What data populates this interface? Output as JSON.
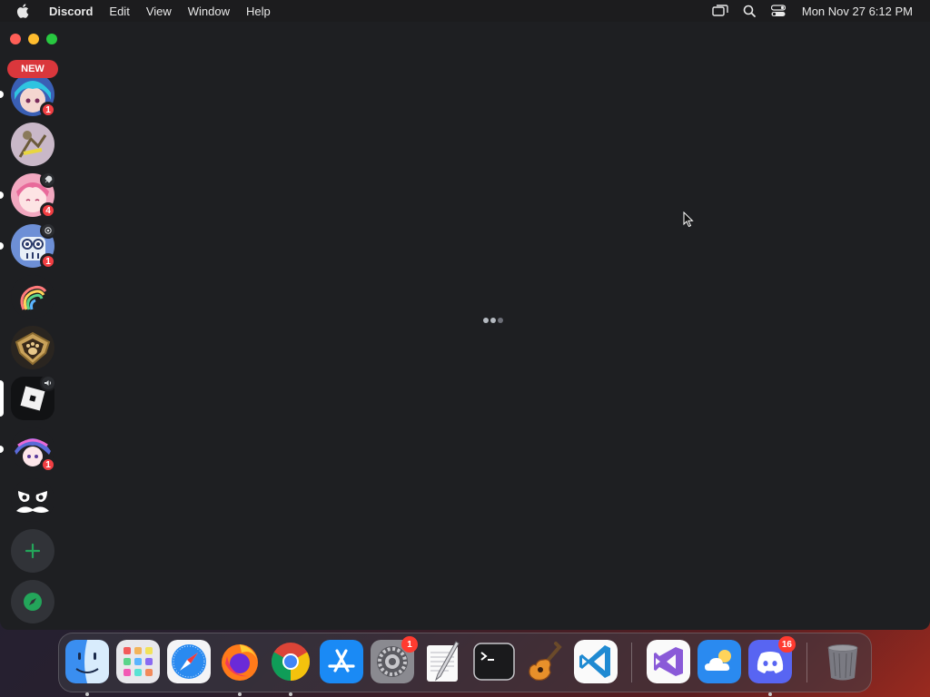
{
  "menubar": {
    "app_name": "Discord",
    "menus": [
      "Edit",
      "View",
      "Window",
      "Help"
    ],
    "clock": "Mon Nov 27  6:12 PM"
  },
  "window": {
    "new_label": "NEW",
    "servers": [
      {
        "id": "server-anime-blue",
        "badge": "1",
        "icon": "anime-avatar"
      },
      {
        "id": "server-sketch",
        "badge": "",
        "icon": "sketch-avatar"
      },
      {
        "id": "server-pink",
        "badge": "4",
        "icon": "anime-pink-avatar",
        "corner": "rocket-icon"
      },
      {
        "id": "server-cartoon",
        "badge": "1",
        "icon": "cartoon-avatar",
        "corner": "broadcast-icon"
      },
      {
        "id": "server-rainbow",
        "badge": "",
        "icon": "rainbow-swirl-logo"
      },
      {
        "id": "server-paw",
        "badge": "",
        "icon": "paw-shield-logo"
      },
      {
        "id": "server-roblox",
        "badge": "",
        "icon": "roblox-logo",
        "corner": "speaker-icon"
      },
      {
        "id": "server-anime-purple",
        "badge": "1",
        "icon": "anime-purple-avatar"
      },
      {
        "id": "server-mustache",
        "badge": "",
        "icon": "mustache-face-logo"
      }
    ],
    "add_server_icon": "plus-icon",
    "explore_icon": "compass-icon",
    "accent": "#23a55a"
  },
  "dock": {
    "apps": [
      {
        "name": "Finder",
        "running": true
      },
      {
        "name": "Launchpad",
        "running": false
      },
      {
        "name": "Safari",
        "running": false
      },
      {
        "name": "Firefox",
        "running": true
      },
      {
        "name": "Chrome",
        "running": true
      },
      {
        "name": "App Store",
        "running": false
      },
      {
        "name": "System Settings",
        "running": false,
        "badge": "1"
      },
      {
        "name": "TextEdit",
        "running": false
      },
      {
        "name": "Terminal",
        "running": false
      },
      {
        "name": "GarageBand",
        "running": false
      },
      {
        "name": "Visual Studio Code",
        "running": false
      },
      {
        "name": "Visual Studio",
        "running": false
      },
      {
        "name": "Weather",
        "running": false
      },
      {
        "name": "Discord",
        "running": true,
        "badge": "16"
      },
      {
        "name": "Trash",
        "running": false
      }
    ],
    "badges": {
      "settings": "1",
      "discord": "16"
    }
  }
}
